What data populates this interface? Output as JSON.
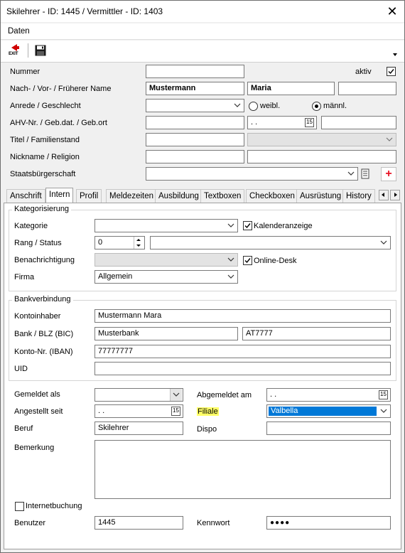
{
  "window": {
    "title": "Skilehrer - ID: 1445 / Vermittler - ID: 1403"
  },
  "menu": {
    "daten": "Daten"
  },
  "toolbar": {
    "exit_label": "EXIT"
  },
  "header": {
    "nummer_label": "Nummer",
    "aktiv_label": "aktiv",
    "aktiv_checked": true,
    "name_label": "Nach- / Vor- / Früherer Name",
    "nachname": "Mustermann",
    "vorname": "Maria",
    "frueherer_name": "",
    "anrede_label": "Anrede / Geschlecht",
    "weibl_label": "weibl.",
    "maennl_label": "männl.",
    "geschlecht_selected": "männl.",
    "ahv_label": "AHV-Nr. / Geb.dat. / Geb.ort",
    "gebdat_value": " .  .",
    "titel_label": "Titel / Familienstand",
    "nickname_label": "Nickname  / Religion",
    "staatsbuerger_label": "Staatsbürgerschaft"
  },
  "tabs": [
    "Anschrift",
    "Intern",
    "Profil",
    "Meldezeiten",
    "Ausbildung",
    "Textboxen",
    "Checkboxen",
    "Ausrüstung",
    "History"
  ],
  "active_tab": "Intern",
  "kategorisierung": {
    "title": "Kategorisierung",
    "kategorie_label": "Kategorie",
    "kalender_label": "Kalenderanzeige",
    "kalender_checked": true,
    "rang_label": "Rang / Status",
    "rang_value": "0",
    "benachrichtigung_label": "Benachrichtigung",
    "online_label": "Online-Desk",
    "online_checked": true,
    "firma_label": "Firma",
    "firma_value": "Allgemein"
  },
  "bank": {
    "title": "Bankverbindung",
    "kontoinhaber_label": "Kontoinhaber",
    "kontoinhaber_value": "Mustermann Mara",
    "bank_label": "Bank / BLZ (BIC)",
    "bank_value": "Musterbank",
    "bic_value": "AT7777",
    "konto_label": "Konto-Nr. (IBAN)",
    "konto_value": "77777777",
    "uid_label": "UID"
  },
  "misc": {
    "gemeldet_label": "Gemeldet als",
    "abgemeldet_label": "Abgemeldet am",
    "abgemeldet_value": " .  .",
    "angestellt_label": "Angestellt seit",
    "angestellt_value": " .  .",
    "filiale_label": "Filiale",
    "filiale_value": "Valbella",
    "beruf_label": "Beruf",
    "beruf_value": "Skilehrer",
    "dispo_label": "Dispo",
    "bemerkung_label": "Bemerkung",
    "internetbuchung_label": "Internetbuchung",
    "internetbuchung_checked": false,
    "benutzer_label": "Benutzer",
    "benutzer_value": "1445",
    "kennwort_label": "Kennwort",
    "kennwort_value": "●●●●"
  },
  "colors": {
    "highlight": "#ffff66",
    "selection": "#0078d7",
    "add_red": "#e81123"
  }
}
